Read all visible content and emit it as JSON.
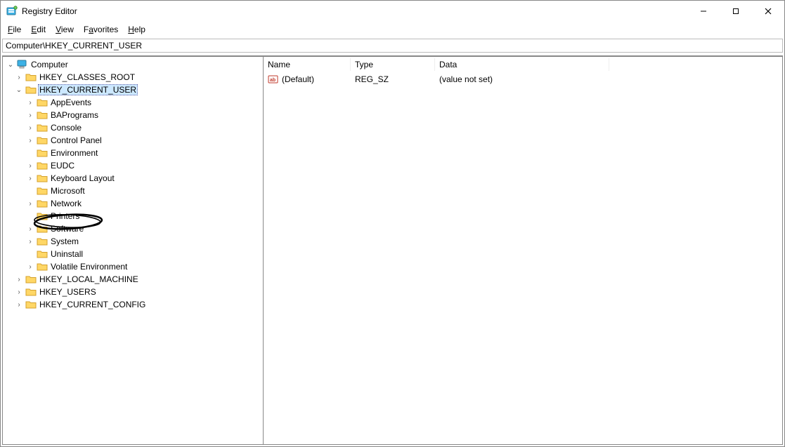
{
  "window": {
    "title": "Registry Editor"
  },
  "menus": {
    "file": "File",
    "edit": "Edit",
    "view": "View",
    "favorites": "Favorites",
    "help": "Help"
  },
  "address": "Computer\\HKEY_CURRENT_USER",
  "tree": {
    "root": "Computer",
    "hives": {
      "classes_root": "HKEY_CLASSES_ROOT",
      "current_user": "HKEY_CURRENT_USER",
      "local_machine": "HKEY_LOCAL_MACHINE",
      "users": "HKEY_USERS",
      "current_config": "HKEY_CURRENT_CONFIG"
    },
    "cu_children": [
      "AppEvents",
      "BAPrograms",
      "Console",
      "Control Panel",
      "Environment",
      "EUDC",
      "Keyboard Layout",
      "Microsoft",
      "Network",
      "Printers",
      "Software",
      "System",
      "Uninstall",
      "Volatile Environment"
    ],
    "cu_expand": [
      true,
      true,
      true,
      true,
      false,
      true,
      true,
      false,
      true,
      false,
      true,
      true,
      false,
      true
    ]
  },
  "list": {
    "headers": {
      "name": "Name",
      "type": "Type",
      "data": "Data"
    },
    "rows": [
      {
        "name": "(Default)",
        "type": "REG_SZ",
        "data": "(value not set)"
      }
    ]
  },
  "icons": {
    "app": "registry-icon",
    "computer": "computer-icon",
    "folder": "folder-icon",
    "regstr": "reg-string-icon"
  }
}
